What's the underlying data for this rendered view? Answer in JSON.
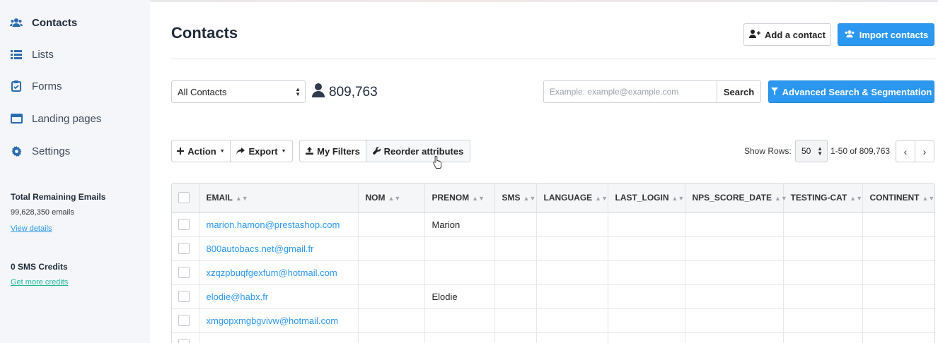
{
  "sidebar": {
    "items": [
      {
        "label": "Contacts",
        "icon": "users-icon",
        "active": true
      },
      {
        "label": "Lists",
        "icon": "list-icon"
      },
      {
        "label": "Forms",
        "icon": "clipboard-icon"
      },
      {
        "label": "Landing pages",
        "icon": "browser-window-icon"
      },
      {
        "label": "Settings",
        "icon": "gear-icon"
      }
    ],
    "emails_title": "Total Remaining Emails",
    "emails_count": "99,628,350 emails",
    "emails_link": "View details",
    "sms_title": "0 SMS Credits",
    "sms_link": "Get more credits"
  },
  "header": {
    "title": "Contacts",
    "add_contact": "Add a contact",
    "import_contacts": "Import contacts"
  },
  "filters": {
    "list_select": "All Contacts",
    "contact_count": "809,763",
    "search_placeholder": "Example: example@example.com",
    "search_button": "Search",
    "advanced_button": "Advanced Search & Segmentation"
  },
  "toolbar": {
    "action": "Action",
    "export": "Export",
    "my_filters": "My Filters",
    "reorder": "Reorder attributes",
    "show_rows_label": "Show Rows:",
    "rows_value": "50",
    "range": "1-50 of 809,763",
    "prev": "‹",
    "next": "›"
  },
  "table": {
    "columns": [
      "EMAIL",
      "NOM",
      "PRENOM",
      "SMS",
      "LANGUAGE",
      "LAST_LOGIN",
      "NPS_SCORE_DATE",
      "TESTING-CAT",
      "CONTINENT"
    ],
    "rows": [
      {
        "email": "marion.hamon@prestashop.com",
        "prenom": "Marion"
      },
      {
        "email": "800autobacs.net@gmail.fr",
        "prenom": ""
      },
      {
        "email": "xzqzpbuqfgexfum@hotmail.com",
        "prenom": ""
      },
      {
        "email": "elodie@habx.fr",
        "prenom": "Elodie"
      },
      {
        "email": "xmgopxmgbgvivw@hotmail.com",
        "prenom": ""
      }
    ]
  },
  "colors": {
    "primary": "#2b97f0",
    "link_blue": "#2b97f0",
    "link_green": "#1fb89a",
    "sidebar_bg": "#f4f6f9",
    "icon_blue": "#2b6cb0"
  }
}
